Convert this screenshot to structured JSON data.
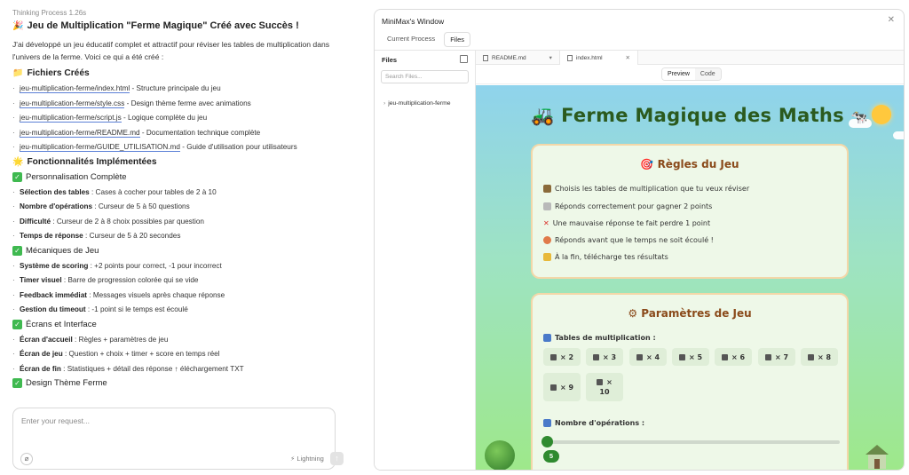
{
  "chat": {
    "thinking": "Thinking Process 1.26s",
    "title": "Jeu de Multiplication \"Ferme Magique\" Créé avec Succès !",
    "intro": "J'ai développé un jeu éducatif complet et attractif pour réviser les tables de multiplication dans l'univers de la ferme. Voici ce qui a été créé :",
    "files_heading": "Fichiers Créés",
    "files": [
      {
        "link": "jeu-multiplication-ferme/index.html",
        "desc": " - Structure principale du jeu"
      },
      {
        "link": "jeu-multiplication-ferme/style.css",
        "desc": " - Design thème ferme avec animations"
      },
      {
        "link": "jeu-multiplication-ferme/script.js",
        "desc": " - Logique complète du jeu"
      },
      {
        "link": "jeu-multiplication-ferme/README.md",
        "desc": " - Documentation technique complète"
      },
      {
        "link": "jeu-multiplication-ferme/GUIDE_UTILISATION.md",
        "desc": " - Guide d'utilisation pour utilisateurs"
      }
    ],
    "features_heading": "Fonctionnalités Implémentées",
    "personalisation_heading": "Personnalisation Complète",
    "personalisation": [
      {
        "b": "Sélection des tables",
        "t": " : Cases à cocher pour tables de 2 à 10"
      },
      {
        "b": "Nombre d'opérations",
        "t": " : Curseur de 5 à 50 questions"
      },
      {
        "b": "Difficulté",
        "t": " : Curseur de 2 à 8 choix possibles par question"
      },
      {
        "b": "Temps de réponse",
        "t": " : Curseur de 5 à 20 secondes"
      }
    ],
    "mecaniques_heading": "Mécaniques de Jeu",
    "mecaniques": [
      {
        "b": "Système de scoring",
        "t": " : +2 points pour correct, -1 pour incorrect"
      },
      {
        "b": "Timer visuel",
        "t": " : Barre de progression colorée qui se vide"
      },
      {
        "b": "Feedback immédiat",
        "t": " : Messages visuels après chaque réponse"
      },
      {
        "b": "Gestion du timeout",
        "t": " : -1 point si le temps est écoulé"
      }
    ],
    "ecrans_heading": "Écrans et Interface",
    "ecrans": [
      {
        "b": "Écran d'accueil",
        "t": " : Règles + paramètres de jeu"
      },
      {
        "b": "Écran de jeu",
        "t": " : Question + choix + timer + score en temps réel"
      },
      {
        "b": "Écran de fin",
        "t": " : Statistiques + détail des réponse  ↑  éléchargement TXT"
      }
    ],
    "design_heading": "Design Thème Ferme",
    "input_placeholder": "Enter your request...",
    "lightning": "Lightning"
  },
  "window": {
    "title": "MiniMax's Window",
    "tabs": [
      "Current Process",
      "Files"
    ],
    "files_label": "Files",
    "search_placeholder": "Search Files...",
    "tree_item": "jeu-multiplication-ferme",
    "editor_tabs": [
      "README.md",
      "index.html"
    ],
    "view_buttons": [
      "Preview",
      "Code"
    ]
  },
  "game": {
    "title": "Ferme Magique des Maths",
    "rules_heading": "Règles du Jeu",
    "rules": [
      "Choisis les tables de multiplication que tu veux réviser",
      "Réponds correctement pour gagner 2 points",
      "Une mauvaise réponse te fait perdre 1 point",
      "Réponds avant que le temps ne soit écoulé !",
      "À la fin, télécharge tes résultats"
    ],
    "params_heading": "Paramètres de Jeu",
    "tables_label": "Tables de multiplication :",
    "tables": [
      "× 2",
      "× 3",
      "× 4",
      "× 5",
      "× 6",
      "× 7",
      "× 8",
      "× 9",
      "×"
    ],
    "table_ten": "10",
    "ops_label": "Nombre d'opérations :",
    "ops_value": "5"
  }
}
